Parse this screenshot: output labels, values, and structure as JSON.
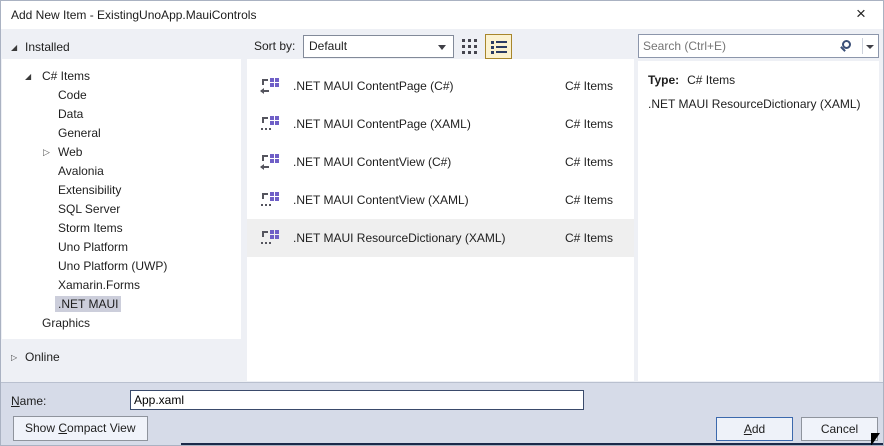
{
  "window": {
    "title": "Add New Item - ExistingUnoApp.MauiControls"
  },
  "icons": {
    "close": "×",
    "expanded": "◢",
    "collapsed": "▷"
  },
  "sidebar": {
    "installed": "Installed",
    "online": "Online",
    "root": "C# Items",
    "items": [
      "Code",
      "Data",
      "General",
      "Web",
      "Avalonia",
      "Extensibility",
      "SQL Server",
      "Storm Items",
      "Uno Platform",
      "Uno Platform (UWP)",
      "Xamarin.Forms",
      ".NET MAUI"
    ],
    "graphics": "Graphics",
    "selected_item": ".NET MAUI"
  },
  "toolbar": {
    "sort_label": "Sort by:",
    "sort_value": "Default"
  },
  "list": {
    "items": [
      {
        "name": ".NET MAUI ContentPage (C#)",
        "category": "C# Items",
        "icon": "maui-contentpage-csharp-icon"
      },
      {
        "name": ".NET MAUI ContentPage (XAML)",
        "category": "C# Items",
        "icon": "maui-contentpage-xaml-icon"
      },
      {
        "name": ".NET MAUI ContentView (C#)",
        "category": "C# Items",
        "icon": "maui-contentview-csharp-icon"
      },
      {
        "name": ".NET MAUI ContentView (XAML)",
        "category": "C# Items",
        "icon": "maui-contentview-xaml-icon"
      },
      {
        "name": ".NET MAUI ResourceDictionary (XAML)",
        "category": "C# Items",
        "icon": "maui-resourcedictionary-xaml-icon"
      }
    ],
    "selected_index": 4
  },
  "search": {
    "placeholder": "Search (Ctrl+E)"
  },
  "details": {
    "type_label": "Type:",
    "type_value": "C# Items",
    "description": ".NET MAUI ResourceDictionary (XAML)"
  },
  "footer": {
    "name_label": {
      "key": "N",
      "post": "ame:"
    },
    "name_value": "App.xaml",
    "compact_button": {
      "pre": "Show ",
      "key": "C",
      "post": "ompact View"
    },
    "add_button": {
      "key": "A",
      "post": "dd"
    },
    "cancel_button": "Cancel"
  },
  "colors": {
    "accent_blue": "#3c69ad",
    "tree_selection": "#cccedb",
    "list_selection": "#efefef",
    "view_toggle_bg": "#fbf2d0",
    "view_toggle_border": "#a8862b",
    "icon_purple": "#6f5fc7",
    "footer_bg": "#d6dbe8",
    "backdrop_strip": "#1b2a4a"
  }
}
